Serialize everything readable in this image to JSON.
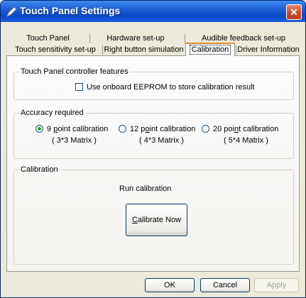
{
  "window": {
    "title": "Touch Panel Settings",
    "close_glyph": "✕",
    "title_icon": "pen-icon"
  },
  "tabs": {
    "row_back": [
      "Touch Panel",
      "Hardware set-up",
      "Audible feedback set-up"
    ],
    "row_front": [
      "Touch sensitivity set-up",
      "Right button simulation",
      "Calibration",
      "Driver Information"
    ],
    "active": "Calibration"
  },
  "controller_group": {
    "label": "Touch Panel controller features",
    "checkbox_label": "Use onboard EEPROM to store calibration result",
    "checked": false
  },
  "accuracy_group": {
    "label": "Accuracy required",
    "options": [
      {
        "label_pre": "9 ",
        "label_u": "p",
        "label_post": "oint calibration",
        "matrix": "( 3*3 Matrix )",
        "selected": true
      },
      {
        "label_pre": "12 p",
        "label_u": "o",
        "label_post": "int calibration",
        "matrix": "( 4*3 Matrix )",
        "selected": false
      },
      {
        "label_pre": "20 poi",
        "label_u": "n",
        "label_post": "t calibration",
        "matrix": "( 5*4 Matrix )",
        "selected": false
      }
    ]
  },
  "calibration_group": {
    "label": "Calibration",
    "run_text": "Run calibration",
    "button_u": "C",
    "button_rest": "alibrate Now"
  },
  "footer": {
    "ok": "OK",
    "cancel": "Cancel",
    "apply": "Apply"
  },
  "colors": {
    "titlebar": "#0a48c8",
    "active_tab_accent": "#e68b2c",
    "radio_dot": "#21a121"
  }
}
